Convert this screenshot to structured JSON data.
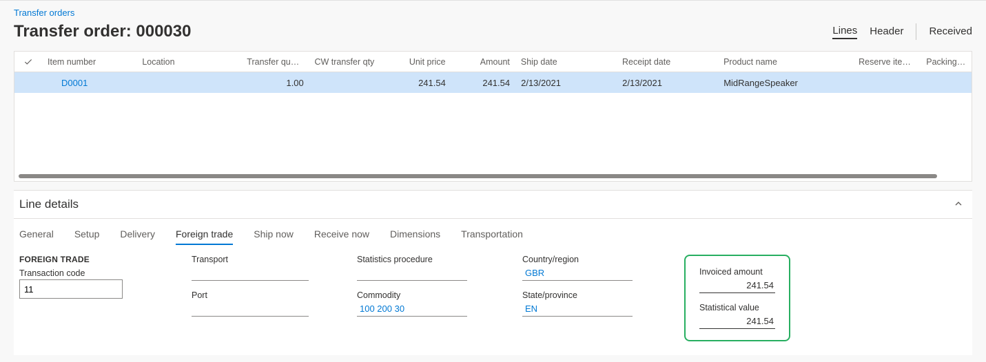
{
  "breadcrumb": {
    "parent_label": "Transfer orders"
  },
  "header": {
    "title": "Transfer order: 000030",
    "tabs": {
      "lines": "Lines",
      "header": "Header",
      "received": "Received"
    }
  },
  "grid": {
    "columns": {
      "item": "Item number",
      "location": "Location",
      "transfer_qty": "Transfer quantity",
      "cw_qty": "CW transfer qty",
      "unit_price": "Unit price",
      "amount": "Amount",
      "ship_date": "Ship date",
      "receipt_date": "Receipt date",
      "product_name": "Product name",
      "reserve_items": "Reserve items a...",
      "packing_qty": "Packing qu"
    },
    "rows": [
      {
        "item": "D0001",
        "location": "",
        "transfer_qty": "1.00",
        "cw_qty": "",
        "unit_price": "241.54",
        "amount": "241.54",
        "ship_date": "2/13/2021",
        "receipt_date": "2/13/2021",
        "product_name": "MidRangeSpeaker",
        "reserve_items": "",
        "packing_qty": ""
      }
    ]
  },
  "details": {
    "title": "Line details",
    "tabs": {
      "general": "General",
      "setup": "Setup",
      "delivery": "Delivery",
      "foreign_trade": "Foreign trade",
      "ship_now": "Ship now",
      "receive_now": "Receive now",
      "dimensions": "Dimensions",
      "transportation": "Transportation"
    },
    "foreign_trade": {
      "section_header": "FOREIGN TRADE",
      "transaction_code_label": "Transaction code",
      "transaction_code_value": "11",
      "transport_label": "Transport",
      "transport_value": "",
      "port_label": "Port",
      "port_value": "",
      "stats_procedure_label": "Statistics procedure",
      "stats_procedure_value": "",
      "commodity_label": "Commodity",
      "commodity_value": "100 200 30",
      "country_label": "Country/region",
      "country_value": "GBR",
      "state_label": "State/province",
      "state_value": "EN",
      "invoiced_label": "Invoiced amount",
      "invoiced_value": "241.54",
      "statistical_label": "Statistical value",
      "statistical_value": "241.54"
    }
  }
}
